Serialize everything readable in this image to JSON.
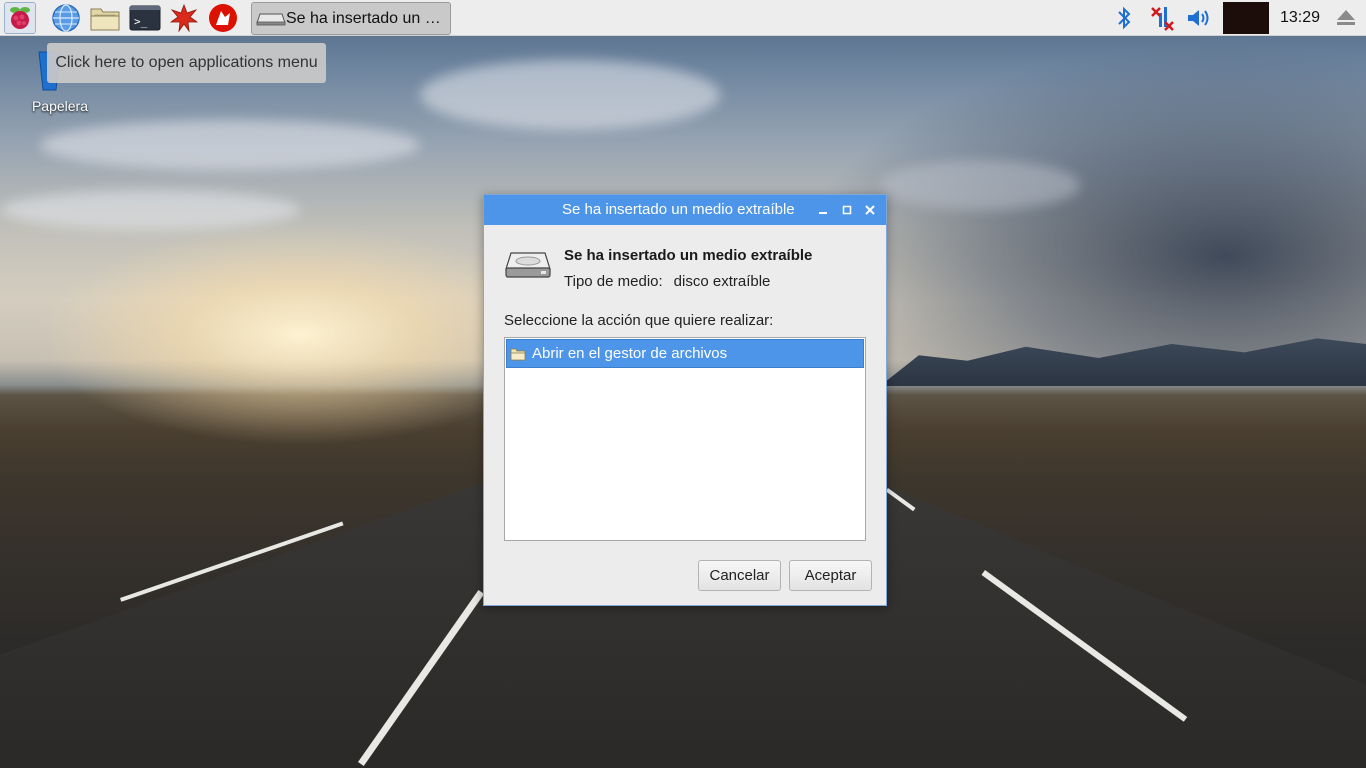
{
  "taskbar": {
    "launchers": [
      {
        "name": "applications-menu",
        "icon": "raspberry-icon"
      },
      {
        "name": "web-browser",
        "icon": "globe-icon"
      },
      {
        "name": "file-manager",
        "icon": "folder-icon"
      },
      {
        "name": "terminal",
        "icon": "terminal-icon"
      },
      {
        "name": "mathematica",
        "icon": "mathematica-icon"
      },
      {
        "name": "wolfram",
        "icon": "wolfram-icon"
      }
    ],
    "task_button_label": "Se ha insertado un medio extraíble",
    "tray_icons": [
      "bluetooth-icon",
      "network-disconnected-icon",
      "volume-icon",
      "cpu-monitor",
      "eject-icon"
    ],
    "clock": "13:29"
  },
  "tooltip": {
    "text": "Click here to open applications menu"
  },
  "desktop": {
    "icons": [
      {
        "label": "Papelera",
        "icon": "trash-icon"
      }
    ]
  },
  "dialog": {
    "title": "Se ha insertado un medio extraíble",
    "heading": "Se ha insertado un medio extraíble",
    "media_type_label": "Tipo de medio:",
    "media_type_value": "disco extraíble",
    "prompt": "Seleccione la acción que quiere realizar:",
    "actions": [
      {
        "label": "Abrir en el gestor de archivos",
        "selected": true,
        "icon": "folder-icon"
      }
    ],
    "buttons": {
      "cancel": "Cancelar",
      "ok": "Aceptar"
    }
  },
  "colors": {
    "titlebar": "#4d95e8",
    "selection": "#4d95e8",
    "panel": "#ededed"
  }
}
